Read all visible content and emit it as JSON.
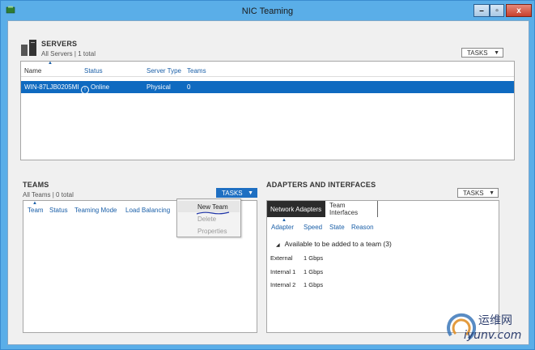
{
  "window": {
    "title": "NIC Teaming",
    "controls": {
      "minimize": "–",
      "maximize": "▫",
      "close": "x"
    }
  },
  "servers": {
    "title": "SERVERS",
    "subtitle": "All Servers | 1 total",
    "tasks_label": "TASKS",
    "columns": [
      "Name",
      "Status",
      "Server Type",
      "Teams"
    ],
    "rows": [
      {
        "name": "WIN-87LJB0205MI",
        "status": "Online",
        "server_type": "Physical",
        "teams": "0"
      }
    ]
  },
  "teams": {
    "title": "TEAMS",
    "subtitle": "All Teams | 0 total",
    "tasks_label": "TASKS",
    "columns": [
      "Team",
      "Status",
      "Teaming Mode",
      "Load Balancing"
    ],
    "menu": {
      "items": [
        "New Team",
        "Delete",
        "Properties"
      ]
    }
  },
  "adapters": {
    "title": "ADAPTERS AND INTERFACES",
    "tasks_label": "TASKS",
    "tabs": [
      "Network Adapters",
      "Team Interfaces"
    ],
    "columns": [
      "Adapter",
      "Speed",
      "State",
      "Reason"
    ],
    "group_label": "Available to be added to a team (3)",
    "rows": [
      {
        "adapter": "External",
        "speed": "1 Gbps"
      },
      {
        "adapter": "Internal 1",
        "speed": "1 Gbps"
      },
      {
        "adapter": "Internal 2",
        "speed": "1 Gbps"
      }
    ]
  },
  "watermark": {
    "cn": "运维网",
    "url": "iyunv.com"
  },
  "colors": {
    "selection": "#0f6ac0",
    "link": "#1a5fa8",
    "titlebar": "#5aaee8"
  }
}
